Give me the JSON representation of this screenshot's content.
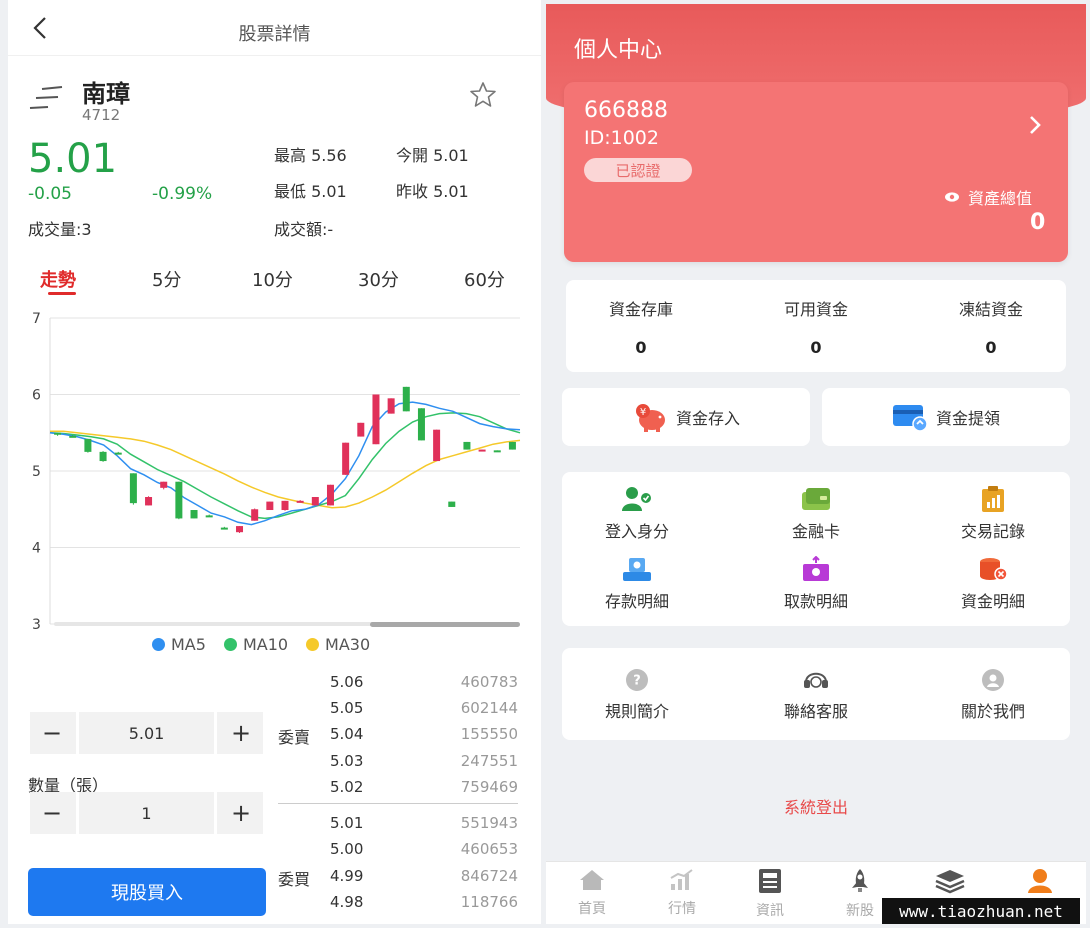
{
  "left": {
    "nav_title": "股票詳情",
    "stock": {
      "name": "南璋",
      "code": "4712",
      "price": "5.01",
      "change": "-0.05",
      "change_pct": "-0.99%",
      "volume": "成交量:3",
      "amount": "成交額:-",
      "high": "最高 5.56",
      "open": "今開 5.01",
      "low": "最低 5.01",
      "prev_close": "昨收 5.01"
    },
    "tabs": [
      "走勢",
      "5分",
      "10分",
      "30分",
      "60分"
    ],
    "active_tab": 0,
    "legend": [
      "MA5",
      "MA10",
      "MA30"
    ],
    "colors": {
      "up": "#e0315a",
      "down": "#2db04b",
      "ma5": "#2f8ff0",
      "ma10": "#33c26a",
      "ma30": "#f5c92a"
    },
    "chart_data": {
      "type": "candlestick",
      "ylim": [
        3,
        7
      ],
      "yticks": [
        "7",
        "6",
        "5",
        "4",
        "3"
      ],
      "candles": [
        {
          "o": 5.5,
          "c": 5.48,
          "h": 5.5,
          "l": 5.46
        },
        {
          "o": 5.46,
          "c": 5.45,
          "h": 5.47,
          "l": 5.44
        },
        {
          "o": 5.42,
          "c": 5.25,
          "h": 5.42,
          "l": 5.24
        },
        {
          "o": 5.25,
          "c": 5.13,
          "h": 5.26,
          "l": 5.12
        },
        {
          "o": 5.24,
          "c": 5.23,
          "h": 5.25,
          "l": 5.22
        },
        {
          "o": 4.97,
          "c": 4.58,
          "h": 4.97,
          "l": 4.56
        },
        {
          "o": 4.55,
          "c": 4.66,
          "h": 4.67,
          "l": 4.55
        },
        {
          "o": 4.78,
          "c": 4.86,
          "h": 4.86,
          "l": 4.76
        },
        {
          "o": 4.86,
          "c": 4.38,
          "h": 4.86,
          "l": 4.37
        },
        {
          "o": 4.49,
          "c": 4.38,
          "h": 4.49,
          "l": 4.38
        },
        {
          "o": 4.42,
          "c": 4.41,
          "h": 4.43,
          "l": 4.41
        },
        {
          "o": 4.26,
          "c": 4.25,
          "h": 4.27,
          "l": 4.24
        },
        {
          "o": 4.2,
          "c": 4.28,
          "h": 4.28,
          "l": 4.19
        },
        {
          "o": 4.35,
          "c": 4.5,
          "h": 4.51,
          "l": 4.35
        },
        {
          "o": 4.49,
          "c": 4.6,
          "h": 4.6,
          "l": 4.49
        },
        {
          "o": 4.49,
          "c": 4.61,
          "h": 4.61,
          "l": 4.48
        },
        {
          "o": 4.6,
          "c": 4.61,
          "h": 4.62,
          "l": 4.6
        },
        {
          "o": 4.55,
          "c": 4.66,
          "h": 4.66,
          "l": 4.55
        },
        {
          "o": 4.55,
          "c": 4.82,
          "h": 4.82,
          "l": 4.55
        },
        {
          "o": 4.95,
          "c": 5.37,
          "h": 5.37,
          "l": 4.95
        },
        {
          "o": 5.45,
          "c": 5.63,
          "h": 5.63,
          "l": 5.45
        },
        {
          "o": 5.35,
          "c": 6.0,
          "h": 6.0,
          "l": 5.35
        },
        {
          "o": 5.75,
          "c": 5.95,
          "h": 5.95,
          "l": 5.75
        },
        {
          "o": 6.1,
          "c": 5.78,
          "h": 6.1,
          "l": 5.78
        },
        {
          "o": 5.82,
          "c": 5.4,
          "h": 5.82,
          "l": 5.4
        },
        {
          "o": 5.13,
          "c": 5.54,
          "h": 5.54,
          "l": 5.13
        },
        {
          "o": 4.6,
          "c": 4.53,
          "h": 4.6,
          "l": 4.53
        },
        {
          "o": 5.38,
          "c": 5.28,
          "h": 5.38,
          "l": 5.28
        },
        {
          "o": 5.27,
          "c": 5.28,
          "h": 5.28,
          "l": 5.27
        },
        {
          "o": 5.27,
          "c": 5.26,
          "h": 5.27,
          "l": 5.26
        },
        {
          "o": 5.38,
          "c": 5.28,
          "h": 5.38,
          "l": 5.28
        }
      ],
      "ma5": [
        5.5,
        5.48,
        5.45,
        5.4,
        5.34,
        5.2,
        5.03,
        4.95,
        4.85,
        4.78,
        4.65,
        4.55,
        4.45,
        4.4,
        4.33,
        4.3,
        4.35,
        4.42,
        4.48,
        4.5,
        4.56,
        4.7,
        4.9,
        5.2,
        5.58,
        5.77,
        5.88,
        5.9,
        5.87,
        5.82,
        5.78,
        5.7,
        5.62,
        5.58,
        5.55,
        5.54
      ],
      "ma10": [
        5.5,
        5.49,
        5.47,
        5.45,
        5.42,
        5.35,
        5.22,
        5.12,
        5.02,
        4.94,
        4.86,
        4.76,
        4.66,
        4.57,
        4.48,
        4.4,
        4.38,
        4.4,
        4.45,
        4.5,
        4.55,
        4.6,
        4.68,
        4.9,
        5.15,
        5.36,
        5.52,
        5.64,
        5.71,
        5.75,
        5.76,
        5.75,
        5.71,
        5.63,
        5.55,
        5.5
      ],
      "ma30": [
        5.52,
        5.52,
        5.5,
        5.48,
        5.46,
        5.44,
        5.42,
        5.39,
        5.34,
        5.28,
        5.2,
        5.12,
        5.04,
        4.96,
        4.87,
        4.79,
        4.72,
        4.66,
        4.62,
        4.58,
        4.55,
        4.52,
        4.53,
        4.58,
        4.66,
        4.75,
        4.86,
        4.97,
        5.07,
        5.15,
        5.2,
        5.25,
        5.3,
        5.35,
        5.38,
        5.4
      ]
    },
    "order_panel": {
      "price_value": "5.01",
      "qty_label": "數量（張）",
      "qty_value": "1",
      "buy_label": "現股買入",
      "minus": "−",
      "plus": "+"
    },
    "orderbook": {
      "sell_label": "委賣",
      "buy_label": "委買",
      "asks": [
        {
          "price": "5.06",
          "vol": "460783"
        },
        {
          "price": "5.05",
          "vol": "602144"
        },
        {
          "price": "5.04",
          "vol": "155550"
        },
        {
          "price": "5.03",
          "vol": "247551"
        },
        {
          "price": "5.02",
          "vol": "759469"
        }
      ],
      "bids": [
        {
          "price": "5.01",
          "vol": "551943"
        },
        {
          "price": "5.00",
          "vol": "460653"
        },
        {
          "price": "4.99",
          "vol": "846724"
        },
        {
          "price": "4.98",
          "vol": "118766"
        }
      ]
    }
  },
  "right": {
    "title": "個人中心",
    "user": {
      "name": "666888",
      "id": "ID:1002",
      "badge": "已認證",
      "asset_label": "資產總值",
      "asset_value": "0"
    },
    "funds": [
      {
        "label": "資金存庫",
        "value": "0"
      },
      {
        "label": "可用資金",
        "value": "0"
      },
      {
        "label": "凍結資金",
        "value": "0"
      }
    ],
    "actions": [
      {
        "label": "資金存入",
        "icon": "piggy-bank-icon"
      },
      {
        "label": "資金提領",
        "icon": "card-withdraw-icon"
      }
    ],
    "menu1": [
      {
        "label": "登入身分",
        "icon": "user-check-icon"
      },
      {
        "label": "金融卡",
        "icon": "bank-card-icon"
      },
      {
        "label": "交易記錄",
        "icon": "clipboard-chart-icon"
      },
      {
        "label": "存款明細",
        "icon": "deposit-tray-icon"
      },
      {
        "label": "取款明細",
        "icon": "withdraw-cash-icon"
      },
      {
        "label": "資金明細",
        "icon": "coins-detail-icon"
      }
    ],
    "menu2": [
      {
        "label": "規則簡介",
        "icon": "question-icon"
      },
      {
        "label": "聯絡客服",
        "icon": "headset-icon"
      },
      {
        "label": "關於我們",
        "icon": "about-icon"
      }
    ],
    "logout": "系統登出",
    "tabbar": [
      {
        "label": "首頁",
        "icon": "home-icon"
      },
      {
        "label": "行情",
        "icon": "market-icon"
      },
      {
        "label": "資訊",
        "icon": "news-icon"
      },
      {
        "label": "新股",
        "icon": "rocket-icon"
      },
      {
        "label": "",
        "icon": "layers-icon"
      },
      {
        "label": "",
        "icon": "user-icon"
      }
    ],
    "active_tab_color": "#f07d1a"
  },
  "watermark": "www.tiaozhuan.net"
}
